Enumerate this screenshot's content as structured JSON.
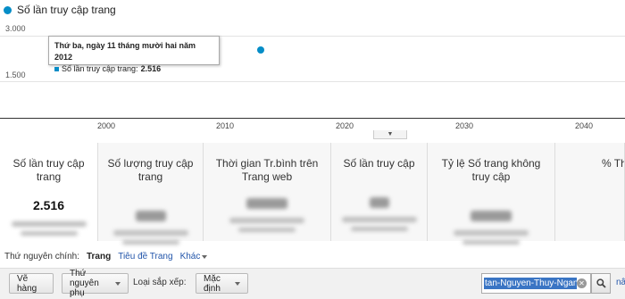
{
  "chart": {
    "legend_label": "Số lần truy cập trang",
    "y_ticks": [
      "3.000",
      "1.500"
    ],
    "x_ticks": [
      "2000",
      "2010",
      "2020",
      "2030",
      "2040"
    ],
    "series_color": "#058dc7",
    "tooltip": {
      "title": "Thứ ba, ngày 11 tháng mười hai năm 2012",
      "row_label": "Số lần truy cập trang:",
      "row_value": "2.516"
    }
  },
  "chart_data": {
    "type": "scatter",
    "title": "",
    "xlabel": "",
    "ylabel": "",
    "series": [
      {
        "name": "Số lần truy cập trang",
        "x": [
          2012.95
        ],
        "y": [
          2516
        ]
      }
    ],
    "x_ticks": [
      2000,
      2010,
      2020,
      2030,
      2040
    ],
    "y_ticks": [
      1500,
      3000
    ],
    "grid": true,
    "legend": "top-left"
  },
  "scorecards": [
    {
      "title": "Số lần truy cập trang",
      "value": "2.516"
    },
    {
      "title": "Số lượng truy cập trang",
      "value": ""
    },
    {
      "title": "Thời gian Tr.bình trên Trang web",
      "value": ""
    },
    {
      "title": "Số lần truy cập",
      "value": ""
    },
    {
      "title": "Tỷ lệ Số trang không truy cập",
      "value": ""
    },
    {
      "title": "% Thoát",
      "value": ""
    }
  ],
  "dimensions": {
    "label": "Thứ nguyên chính:",
    "active": "Trang",
    "link": "Tiêu đề Trang",
    "more": "Khác"
  },
  "toolbar": {
    "plot_rows": "Vẽ hàng",
    "secondary_dim": "Thứ nguyên phụ",
    "sort_label": "Loại sắp xếp:",
    "sort_value": "Mặc định",
    "search_value": "tan-Nguyen-Thuy-Ngan",
    "advanced_cut": "nâ"
  }
}
